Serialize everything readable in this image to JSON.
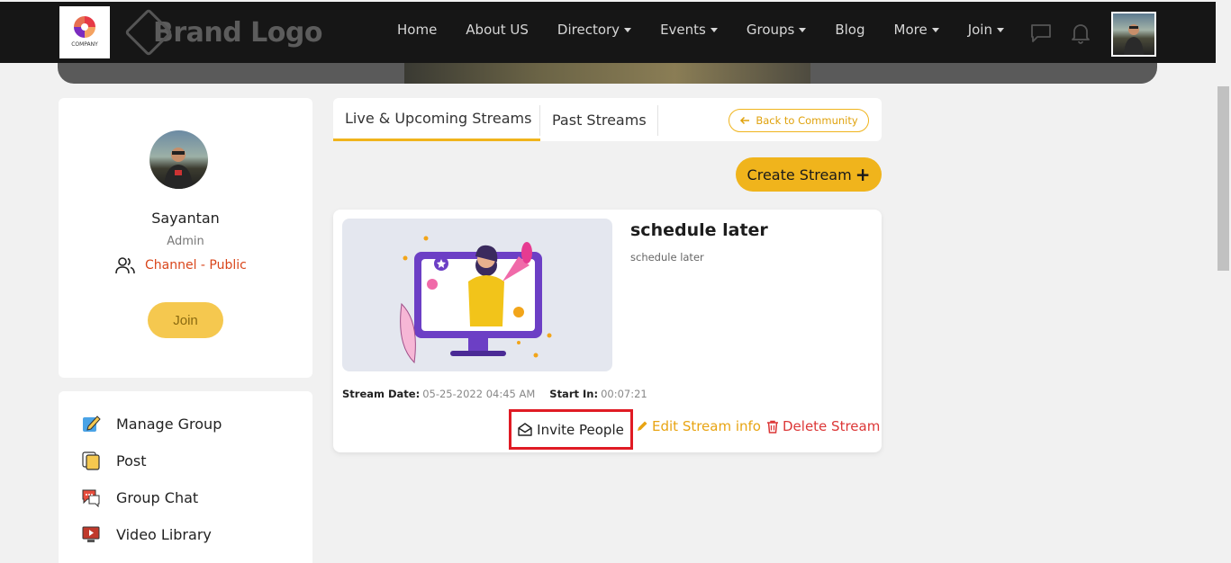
{
  "navbar": {
    "company_logo_text": "COMPANY",
    "brand_text": "Brand Logo",
    "items": [
      {
        "label": "Home",
        "dropdown": false
      },
      {
        "label": "About US",
        "dropdown": false
      },
      {
        "label": "Directory",
        "dropdown": true
      },
      {
        "label": "Events",
        "dropdown": true
      },
      {
        "label": "Groups",
        "dropdown": true
      },
      {
        "label": "Blog",
        "dropdown": false
      },
      {
        "label": "More",
        "dropdown": true
      },
      {
        "label": "Join",
        "dropdown": true
      }
    ]
  },
  "profile": {
    "name": "Sayantan",
    "role": "Admin",
    "channel": "Channel - Public",
    "join_label": "Join"
  },
  "menu": {
    "items": [
      {
        "label": "Manage Group",
        "icon": "edit-icon"
      },
      {
        "label": "Post",
        "icon": "post-icon"
      },
      {
        "label": "Group Chat",
        "icon": "chat-bubble-icon"
      },
      {
        "label": "Video Library",
        "icon": "video-library-icon"
      }
    ]
  },
  "tabs": {
    "live": "Live & Upcoming Streams",
    "past": "Past Streams",
    "back": "Back to Community"
  },
  "create_stream_label": "Create Stream",
  "stream": {
    "title": "schedule later",
    "description": "schedule later",
    "date_label": "Stream Date:",
    "date_value": "05-25-2022 04:45 AM",
    "start_label": "Start In:",
    "start_value": "00:07:21",
    "invite_label": "Invite People",
    "edit_label": "Edit Stream info",
    "delete_label": "Delete Stream"
  },
  "colors": {
    "accent": "#f0b41c",
    "danger": "#dc3737",
    "channel": "#d9461b",
    "highlight_box": "#e01b24"
  }
}
